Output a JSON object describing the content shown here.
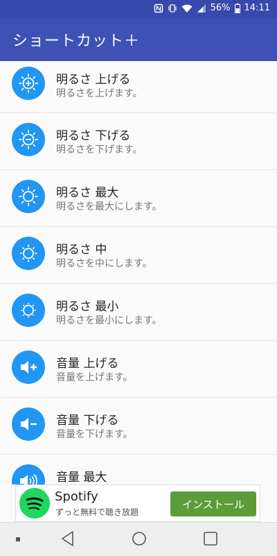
{
  "status": {
    "battery": "56%",
    "time": "14:11"
  },
  "app": {
    "title": "ショートカット＋"
  },
  "items": [
    {
      "title": "明るさ 上げる",
      "subtitle": "明るさを上げます。",
      "icon": "brightness-up-icon"
    },
    {
      "title": "明るさ 下げる",
      "subtitle": "明るさを下げます。",
      "icon": "brightness-down-icon"
    },
    {
      "title": "明るさ 最大",
      "subtitle": "明るさを最大にします。",
      "icon": "brightness-max-icon"
    },
    {
      "title": "明るさ 中",
      "subtitle": "明るさを中にします。",
      "icon": "brightness-medium-icon"
    },
    {
      "title": "明るさ 最小",
      "subtitle": "明るさを最小にします。",
      "icon": "brightness-min-icon"
    },
    {
      "title": "音量 上げる",
      "subtitle": "音量を上げます。",
      "icon": "volume-up-icon"
    },
    {
      "title": "音量 下げる",
      "subtitle": "音量を下げます。",
      "icon": "volume-down-icon"
    },
    {
      "title": "音量 最大",
      "subtitle": "",
      "icon": "volume-max-icon"
    }
  ],
  "ad": {
    "title": "Spotify",
    "subtitle": "ずっと無料で聴き放題",
    "button": "インストール"
  },
  "colors": {
    "appbar": "#3f51b5",
    "statusbar": "#3949ab",
    "icon_bg": "#2196f3",
    "ad_button": "#5d9c3a",
    "spotify": "#1ed760"
  }
}
